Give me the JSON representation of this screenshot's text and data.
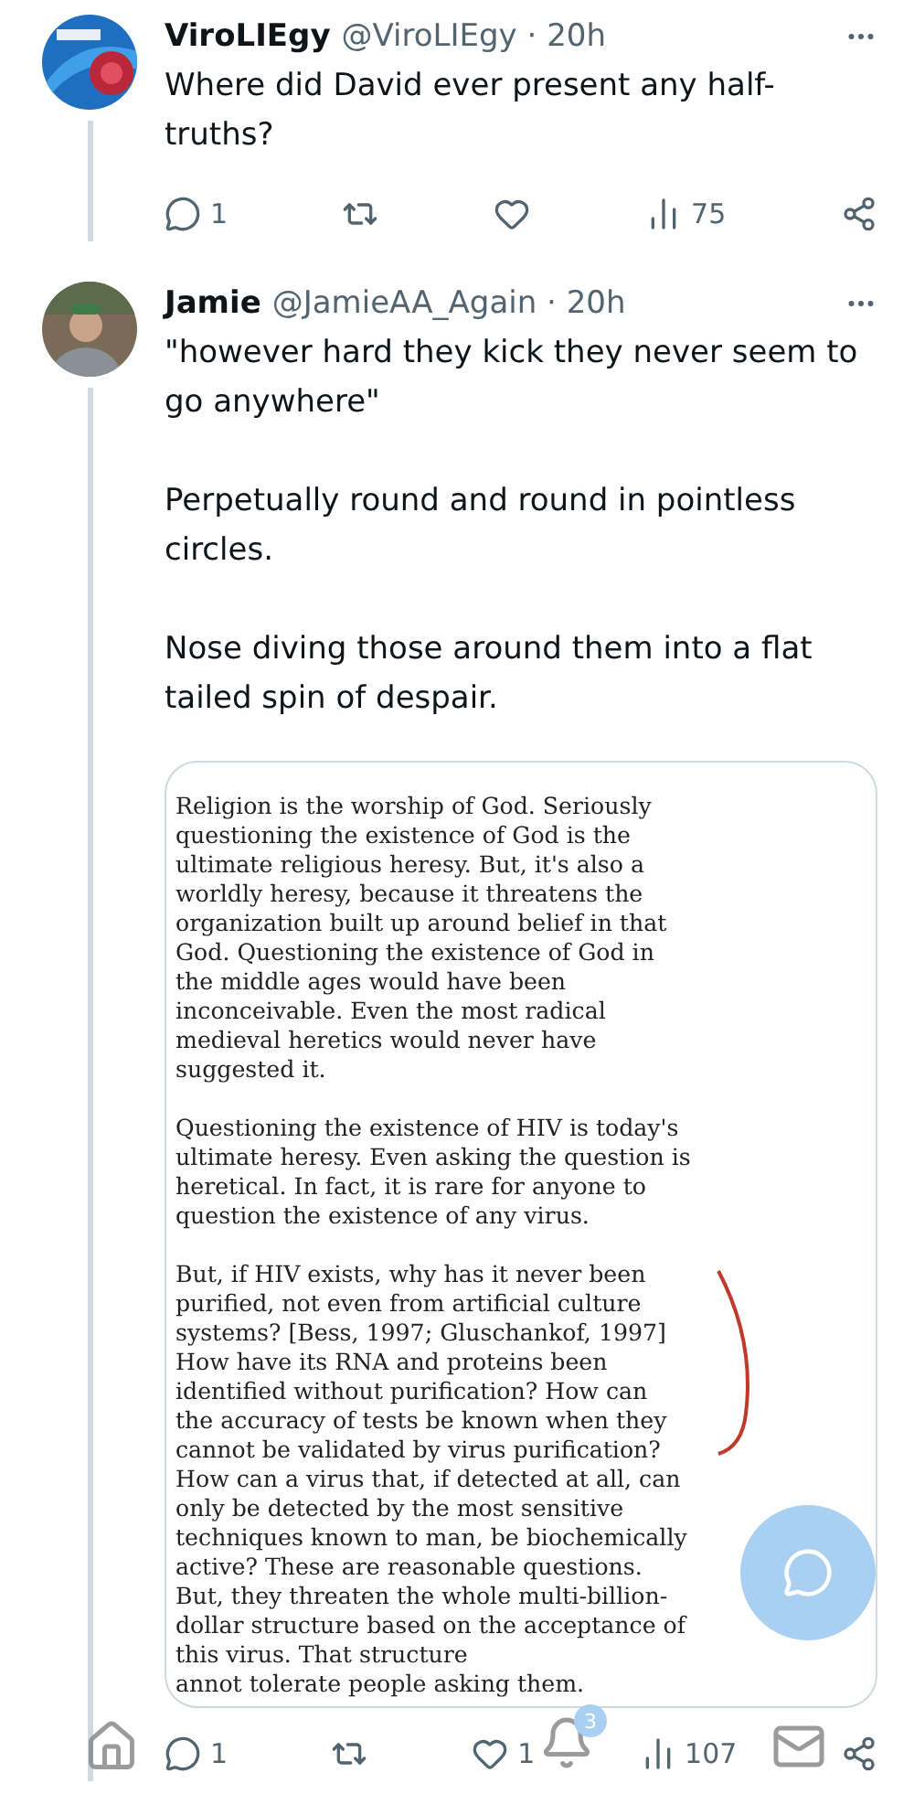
{
  "tweets": [
    {
      "name": "ViroLIEgy",
      "meta": "@ViroLIEgy · 20h",
      "paragraphs": [
        "Where did David ever present any half-truths?"
      ],
      "actions": {
        "replies": "1",
        "views": "75"
      }
    },
    {
      "name": "Jamie",
      "meta": "@JamieAA_Again · 20h",
      "paragraphs": [
        "\"however hard they kick they never seem to go anywhere\"",
        "Perpetually round and round in pointless circles.",
        "Nose diving those around them into a flat tailed spin of despair."
      ],
      "document": {
        "paragraphs": [
          "Religion is the worship of God. Seriously questioning the existence of God is the ultimate religious heresy. But, it's also a worldly heresy, because it threatens the organization built up around belief in that God. Questioning the existence of God in the middle ages would have been inconceivable. Even the most radical medieval heretics would never have suggested it.",
          "Questioning the existence of HIV is today's ultimate heresy. Even asking the question is heretical. In fact, it is rare for anyone to question the existence of any virus.",
          "But, if HIV exists, why has it never been purified, not even from artificial culture systems? [Bess, 1997; Gluschankof, 1997] How have its RNA and proteins been identified without purification? How can the accuracy of tests be known when they cannot be validated by virus purification? How can a virus that, if detected at all, can only be detected by the most sensitive techniques known to man, be biochemically active? These are reasonable questions. But, they threaten the whole multi-billion-dollar structure based on the acceptance of this virus. That structure",
          "annot tolerate people asking them."
        ]
      },
      "actions": {
        "replies": "1",
        "likes": "1",
        "views": "107"
      }
    }
  ],
  "nav": {
    "notification_badge": "3"
  }
}
